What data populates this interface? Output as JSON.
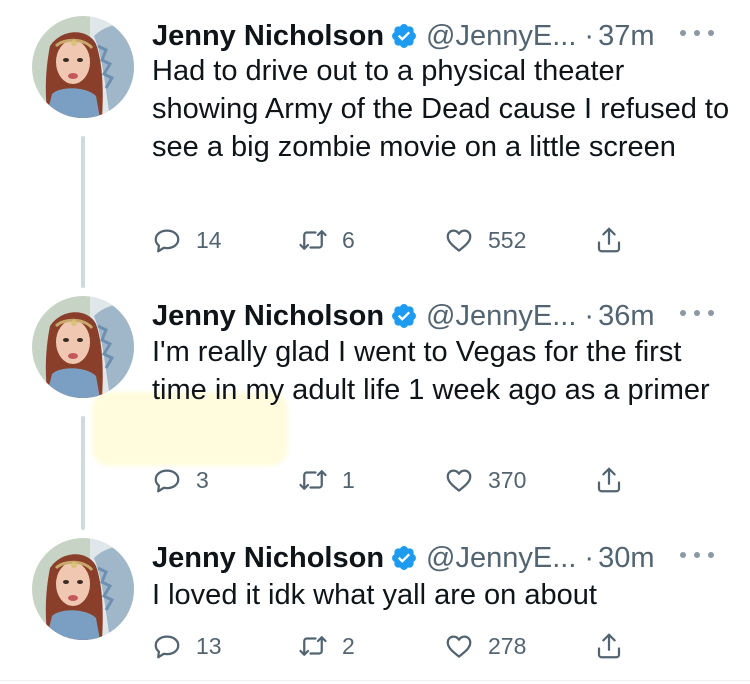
{
  "colors": {
    "verified": "#1d9bf0",
    "muted_text": "#536471",
    "thread_line": "#cfd9de",
    "highlight": "#fffbd9"
  },
  "tweets": [
    {
      "name": "Jenny Nicholson",
      "handle": "@JennyE...",
      "separator": "·",
      "time": "37m",
      "text": "Had to drive out to a physical theater showing Army of the Dead cause I refused to see a big zombie movie on a little screen",
      "replies": "14",
      "retweets": "6",
      "likes": "552",
      "icons": [
        "reply-icon",
        "retweet-icon",
        "like-icon",
        "share-icon"
      ]
    },
    {
      "name": "Jenny Nicholson",
      "handle": "@JennyE...",
      "separator": "·",
      "time": "36m",
      "text": "I'm really glad I went to Vegas for the first time in my adult life 1 week ago as a primer",
      "replies": "3",
      "retweets": "1",
      "likes": "370",
      "icons": [
        "reply-icon",
        "retweet-icon",
        "like-icon",
        "share-icon"
      ]
    },
    {
      "name": "Jenny Nicholson",
      "handle": "@JennyE...",
      "separator": "·",
      "time": "30m",
      "text": "I loved it idk what yall are on about",
      "replies": "13",
      "retweets": "2",
      "likes": "278",
      "icons": [
        "reply-icon",
        "retweet-icon",
        "like-icon",
        "share-icon"
      ]
    }
  ]
}
